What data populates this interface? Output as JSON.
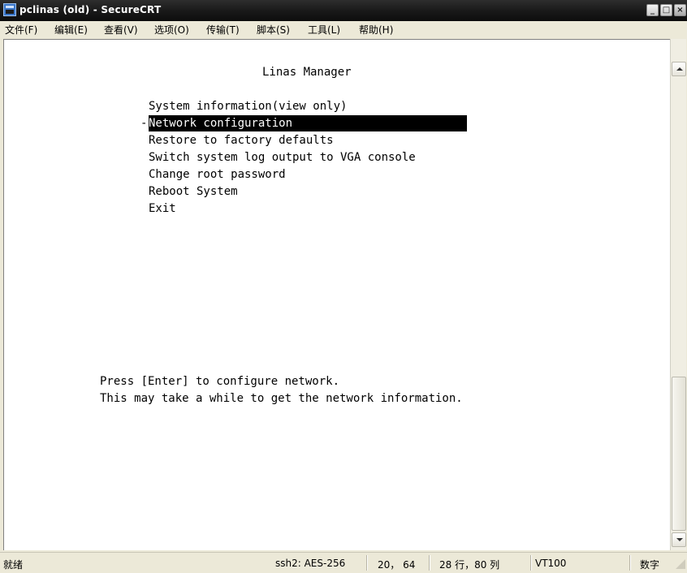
{
  "window": {
    "title": "pclinas (old) - SecureCRT",
    "min_label": "_",
    "max_label": "□",
    "close_label": "×"
  },
  "menu": {
    "items": [
      {
        "label": "文件(F)"
      },
      {
        "label": "编辑(E)"
      },
      {
        "label": "查看(V)"
      },
      {
        "label": "选项(O)"
      },
      {
        "label": "传输(T)"
      },
      {
        "label": "脚本(S)"
      },
      {
        "label": "工具(L)"
      },
      {
        "label": "帮助(H)"
      }
    ]
  },
  "terminal": {
    "header": "Linas Manager",
    "menu_options": [
      "System information(view only)",
      "Network configuration",
      "Restore to factory defaults",
      "Switch system log output to VGA console",
      "Change root password",
      "Reboot System",
      "Exit"
    ],
    "selected_index": 1,
    "cursor_marker": "-",
    "hint_line1": "Press [Enter] to configure network.",
    "hint_line2": "This may take a while to get the network information."
  },
  "status": {
    "ready": "就绪",
    "encryption": "ssh2: AES-256",
    "cursor_pos": "20， 64",
    "dimensions": "28 行，80 列",
    "terminal_type": "VT100",
    "numlock": "数字"
  },
  "colors": {
    "titlebar": "#1a1a1a",
    "terminal_bg": "#ffffff",
    "highlight_bg": "#000000",
    "chrome": "#ece9d8"
  }
}
